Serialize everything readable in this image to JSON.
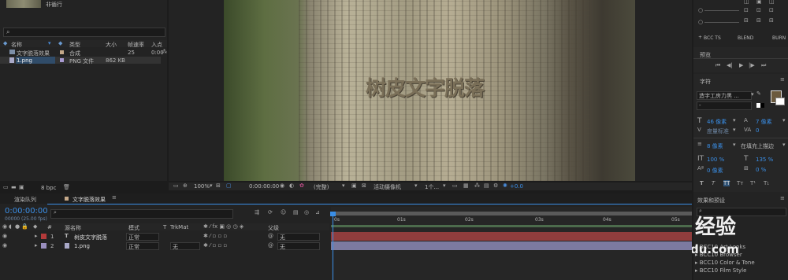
{
  "project": {
    "thumb_caption": "非循行",
    "search_placeholder": "",
    "col_name": "名称",
    "col_type": "类型",
    "col_size": "大小",
    "col_fps": "帧速率",
    "col_in": "入点",
    "rows": [
      {
        "name": "文字脱落效果",
        "type": "合成",
        "size": "",
        "fps": "25",
        "in": "0:00"
      },
      {
        "name": "1.png",
        "type": "PNG 文件",
        "size": "862 KB",
        "fps": "",
        "in": ""
      }
    ],
    "bpc": "8 bpc"
  },
  "viewer": {
    "overlay_text": "树皮文字脱落",
    "zoom": "100%",
    "timecode": "0:00:00:00",
    "resolution": "(完整)",
    "camera": "活动摄像机",
    "views": "1个...",
    "exposure": "+0.0"
  },
  "align": {
    "labels": [
      "BCC TS",
      "BLEND",
      "BURN"
    ]
  },
  "preview": {
    "title": "预览"
  },
  "character": {
    "title": "字符",
    "font": "造字工房力黑 ...",
    "style": "-",
    "size": "46 像素",
    "leading": "7 像素",
    "kerning": "度量标准",
    "tracking": "0",
    "stroke": "8 像素",
    "stroke_type": "在填充上描边",
    "vscale": "100 %",
    "hscale": "135 %",
    "baseline": "0 像素",
    "tsume": "0 %",
    "fill_color": "#6b5a3e"
  },
  "effects": {
    "title": "效果和预设",
    "items": [
      "BCC10 Art Looks",
      "BCC10 Browser",
      "BCC10 Color & Tone",
      "BCC10 Film Style"
    ]
  },
  "timeline": {
    "tab_render": "渲染队列",
    "tab_comp": "文字脱落效果",
    "timecode": "0:00:00:00",
    "frames": "00000 (25.00 fps)",
    "col_source": "源名称",
    "col_mode": "模式",
    "col_trkmat": "TrkMat",
    "col_parent": "父级",
    "ruler": [
      "0s",
      "01s",
      "02s",
      "03s",
      "04s",
      "05s"
    ],
    "layers": [
      {
        "num": "1",
        "name": "树皮文字脱落",
        "mode": "正常",
        "trkmat": "",
        "parent": "无",
        "color": "#b33a3a",
        "bar": "#8f3d3d"
      },
      {
        "num": "2",
        "name": "1.png",
        "mode": "正常",
        "trkmat": "无",
        "parent": "无",
        "color": "#9a8fbf",
        "bar": "#7c7aa0"
      }
    ]
  },
  "watermark": {
    "line1": "经验",
    "line2": "du.com"
  }
}
